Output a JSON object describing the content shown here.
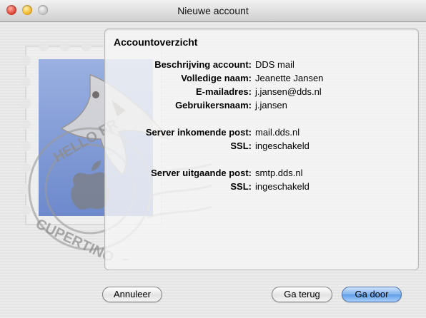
{
  "window": {
    "title": "Nieuwe account"
  },
  "stamp": {
    "text_top": "HELLO FR",
    "text_bottom": "CUPERTINO, CA"
  },
  "panel": {
    "title": "Accountoverzicht",
    "rows": [
      {
        "label": "Beschrijving account:",
        "value": "DDS mail"
      },
      {
        "label": "Volledige naam:",
        "value": "Jeanette Jansen"
      },
      {
        "label": "E-mailadres:",
        "value": "j.jansen@dds.nl"
      },
      {
        "label": "Gebruikersnaam:",
        "value": "j.jansen"
      },
      {
        "label": "Server inkomende post:",
        "value": "mail.dds.nl"
      },
      {
        "label": "SSL:",
        "value": "ingeschakeld"
      },
      {
        "label": "Server uitgaande post:",
        "value": "smtp.dds.nl"
      },
      {
        "label": "SSL:",
        "value": "ingeschakeld"
      }
    ]
  },
  "buttons": {
    "cancel": "Annuleer",
    "back": "Ga terug",
    "continue": "Ga door"
  },
  "colors": {
    "primary_button": "#6aa6ea",
    "stamp_blue": "#6f8fd0"
  }
}
